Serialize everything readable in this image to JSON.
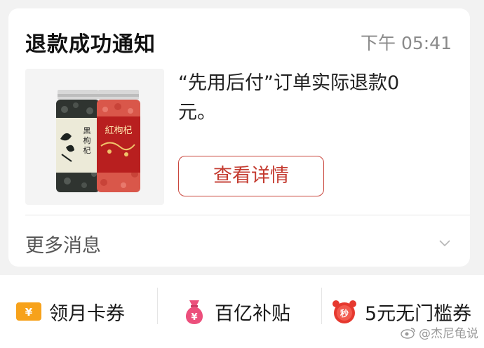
{
  "notification": {
    "title": "退款成功通知",
    "time": "下午 05:41",
    "message": "“先用后付”订单实际退款0元。",
    "detail_button": "查看详情",
    "more_label": "更多消息",
    "product_labels": {
      "left_jar": "黑枸杞",
      "right_jar": "紅枸杞"
    }
  },
  "bottom_bar": {
    "items": [
      {
        "label": "领月卡券",
        "icon": "coupon-icon"
      },
      {
        "label": "百亿补贴",
        "icon": "money-bag-icon"
      },
      {
        "label": "5元无门槛券",
        "icon": "alarm-clock-icon"
      }
    ]
  },
  "watermark": "@杰尼龟说",
  "colors": {
    "accent_red": "#c43b30",
    "coupon_orange": "#f7a21b",
    "bag_pink": "#ec4f7c",
    "clock_red": "#e6392f"
  }
}
